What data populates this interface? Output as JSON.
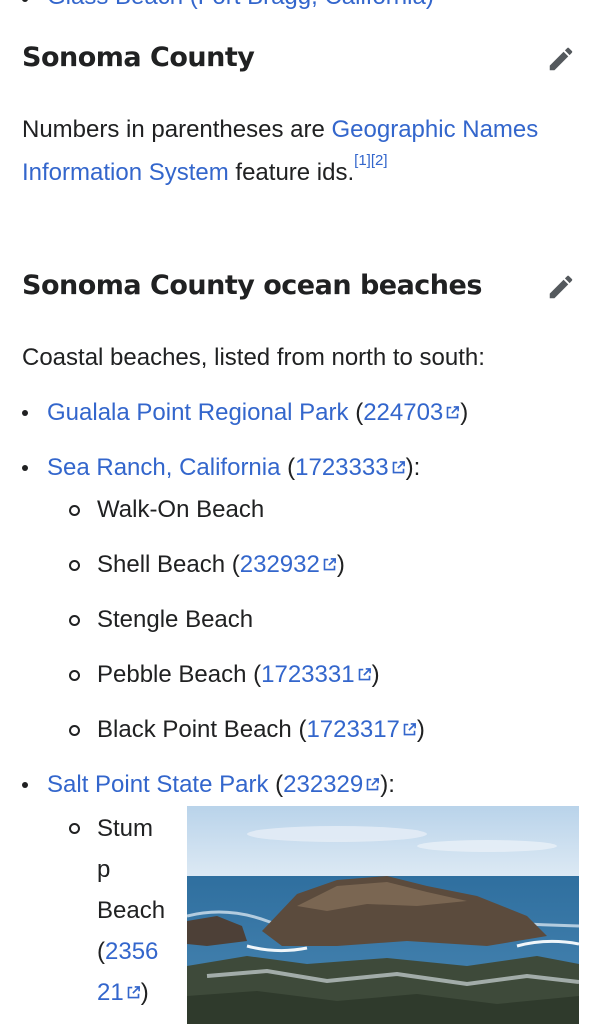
{
  "top_item": {
    "label": "Glass Beach (Fort Bragg, California)"
  },
  "section1": {
    "title": "Sonoma County",
    "para_prefix": "Numbers in parentheses are ",
    "para_link": "Geographic Names Information System",
    "para_suffix": " feature ids.",
    "ref1": "[1]",
    "ref2": "[2]"
  },
  "section2": {
    "title": "Sonoma County ocean beaches",
    "intro": "Coastal beaches, listed from north to south:"
  },
  "items": {
    "gualala": {
      "name": "Gualala Point Regional Park",
      "id": "224703"
    },
    "sea_ranch": {
      "name": "Sea Ranch, California",
      "id": "1723333"
    },
    "walk_on": {
      "name": "Walk-On Beach"
    },
    "shell": {
      "name": "Shell Beach",
      "id": "232932"
    },
    "stengle": {
      "name": "Stengle Beach"
    },
    "pebble": {
      "name": "Pebble Beach",
      "id": "1723331"
    },
    "black_point": {
      "name": "Black Point Beach",
      "id": "1723317"
    },
    "salt_point": {
      "name": "Salt Point State Park",
      "id": "232329"
    },
    "stump": {
      "name_line1": "Stum",
      "name_line2": "p",
      "name_line3": "Beach",
      "id_line1": "2356",
      "id_line2": "21"
    }
  },
  "punct": {
    "open": "(",
    "close": ")",
    "close_colon": "):"
  },
  "icons": {
    "edit": "pencil-edit-icon",
    "external": "external-link-icon"
  },
  "colors": {
    "link": "#3366cc",
    "text": "#202122"
  }
}
